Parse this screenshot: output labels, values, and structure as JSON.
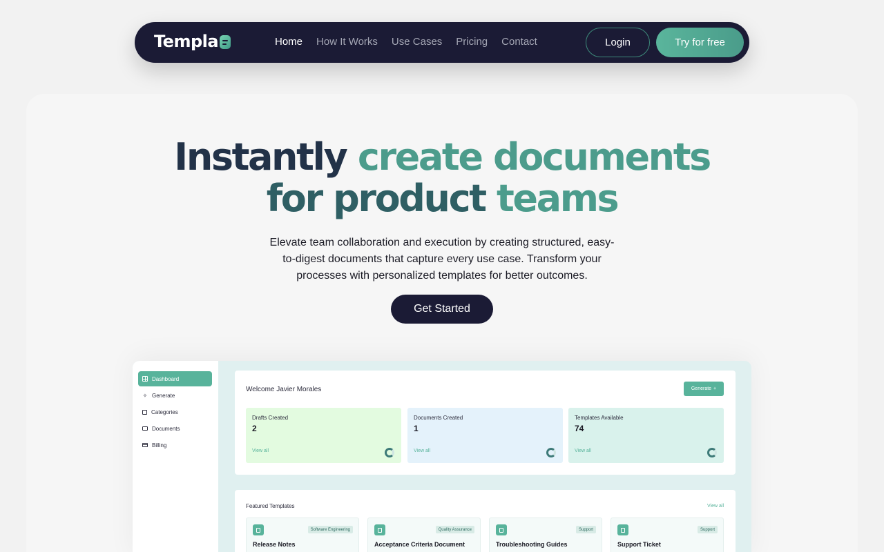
{
  "nav": {
    "logo": "Templa",
    "links": [
      "Home",
      "How It Works",
      "Use Cases",
      "Pricing",
      "Contact"
    ],
    "login": "Login",
    "try": "Try for free"
  },
  "hero": {
    "title_line1_a": "Instantly ",
    "title_line1_b": "create documents",
    "title_line2_a": "for product ",
    "title_line2_b": "teams",
    "subtitle": "Elevate team collaboration and execution by creating structured, easy-to-digest documents that capture every use case. Transform your processes with personalized templates for better outcomes.",
    "cta": "Get Started"
  },
  "dashboard": {
    "sidebar": [
      "Dashboard",
      "Generate",
      "Categories",
      "Documents",
      "Billing"
    ],
    "welcome": "Welcome Javier Morales",
    "generate": "Generate",
    "stats": [
      {
        "label": "Drafts Created",
        "value": "2",
        "link": "View all",
        "bg": "#e3fbe0"
      },
      {
        "label": "Documents Created",
        "value": "1",
        "link": "View all",
        "bg": "#e4f2fb"
      },
      {
        "label": "Templates Available",
        "value": "74",
        "link": "View all",
        "bg": "#d9f2ec"
      }
    ],
    "featured_title": "Featured Templates",
    "featured_view": "View all",
    "templates": [
      {
        "badge": "Software Engineering",
        "title": "Release Notes"
      },
      {
        "badge": "Quality Assurance",
        "title": "Acceptance Criteria Document"
      },
      {
        "badge": "Support",
        "title": "Troubleshooting Guides"
      },
      {
        "badge": "Support",
        "title": "Support Ticket"
      }
    ]
  },
  "colors": {
    "navy": "#1b1b35",
    "accent": "#58b39b"
  }
}
